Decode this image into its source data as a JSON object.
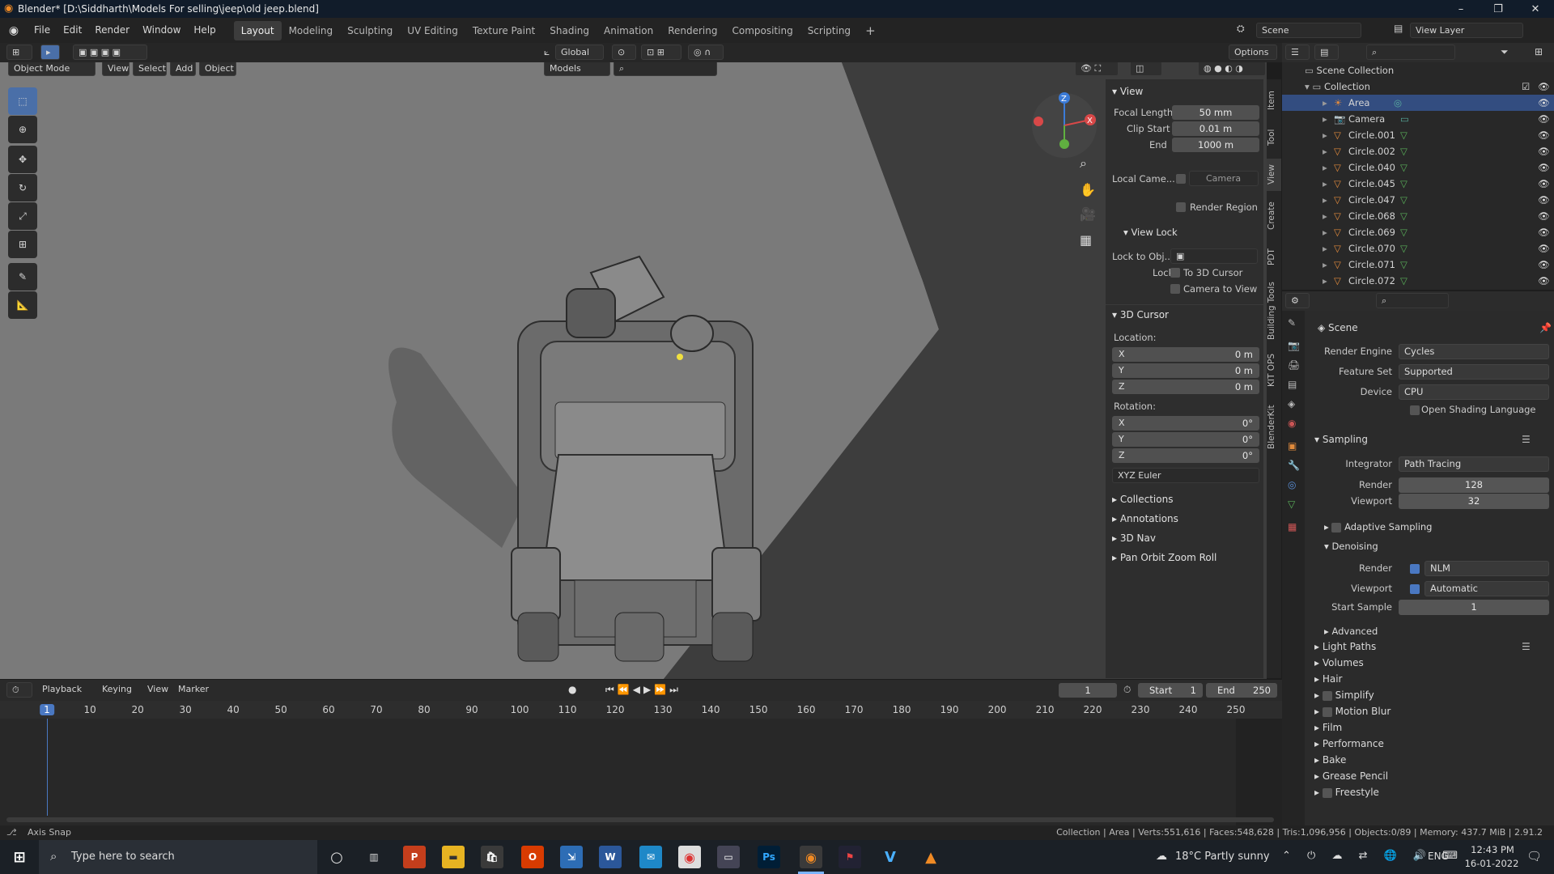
{
  "window": {
    "title": "Blender* [D:\\Siddharth\\Models For selling\\jeep\\old jeep.blend]",
    "minimize": "–",
    "restore": "❐",
    "close": "✕"
  },
  "menu": [
    "File",
    "Edit",
    "Render",
    "Window",
    "Help"
  ],
  "workspaces": [
    "Layout",
    "Modeling",
    "Sculpting",
    "UV Editing",
    "Texture Paint",
    "Shading",
    "Animation",
    "Rendering",
    "Compositing",
    "Scripting"
  ],
  "scene": {
    "name": "Scene",
    "view_layer": "View Layer"
  },
  "header": {
    "transform_orientation": "Global",
    "options": "Options",
    "mode": "Object Mode",
    "view": "View",
    "select": "Select",
    "add": "Add",
    "object": "Object",
    "collection_filter": "Models"
  },
  "npanel": {
    "view_title": "View",
    "focal_length_label": "Focal Length",
    "focal_length": "50 mm",
    "clip_start_label": "Clip Start",
    "clip_start": "0.01 m",
    "end_label": "End",
    "clip_end": "1000 m",
    "local_camera_label": "Local Came...",
    "local_camera": "Camera",
    "render_region": "Render Region",
    "view_lock_title": "View Lock",
    "lock_to_obj_label": "Lock to Obj...",
    "lock_label": "Lock",
    "to_3d_cursor": "To 3D Cursor",
    "camera_to_view": "Camera to View",
    "cursor_title": "3D Cursor",
    "location_label": "Location:",
    "loc_x": "0 m",
    "loc_y": "0 m",
    "loc_z": "0 m",
    "rotation_label": "Rotation:",
    "rot_x": "0°",
    "rot_y": "0°",
    "rot_z": "0°",
    "rotation_mode": "XYZ Euler",
    "x": "X",
    "y": "Y",
    "z": "Z",
    "panels": [
      "Collections",
      "Annotations",
      "3D Nav",
      "Pan Orbit Zoom Roll"
    ]
  },
  "sidebar_tabs": [
    "Item",
    "Tool",
    "View",
    "Create",
    "PDT",
    "Building Tools",
    "KIT OPS",
    "BlenderKit"
  ],
  "outliner": {
    "scene_collection": "Scene Collection",
    "collection": "Collection",
    "items": [
      "Area",
      "Camera",
      "Circle.001",
      "Circle.002",
      "Circle.040",
      "Circle.045",
      "Circle.047",
      "Circle.068",
      "Circle.069",
      "Circle.070",
      "Circle.071",
      "Circle.072"
    ]
  },
  "properties": {
    "scene": "Scene",
    "render_engine_label": "Render Engine",
    "render_engine": "Cycles",
    "feature_set_label": "Feature Set",
    "feature_set": "Supported",
    "device_label": "Device",
    "device": "CPU",
    "osl": "Open Shading Language",
    "sampling": "Sampling",
    "integrator_label": "Integrator",
    "integrator": "Path Tracing",
    "render_label": "Render",
    "render_samples": "128",
    "viewport_label": "Viewport",
    "viewport_samples": "32",
    "adaptive_sampling": "Adaptive Sampling",
    "denoising": "Denoising",
    "denoise_render": "NLM",
    "denoise_viewport": "Automatic",
    "start_sample_label": "Start Sample",
    "start_sample": "1",
    "advanced": "Advanced",
    "sections": [
      "Light Paths",
      "Volumes",
      "Hair",
      "Simplify",
      "Motion Blur",
      "Film",
      "Performance",
      "Bake",
      "Grease Pencil",
      "Freestyle"
    ]
  },
  "timeline": {
    "playback": "Playback",
    "keying": "Keying",
    "view": "View",
    "marker": "Marker",
    "current_frame": "1",
    "start_label": "Start",
    "start": "1",
    "end_label": "End",
    "end": "250",
    "ruler": [
      "1",
      "10",
      "20",
      "30",
      "40",
      "50",
      "60",
      "70",
      "80",
      "90",
      "100",
      "110",
      "120",
      "130",
      "140",
      "150",
      "160",
      "170",
      "180",
      "190",
      "200",
      "210",
      "220",
      "230",
      "240",
      "250"
    ]
  },
  "status": {
    "left": "Axis Snap",
    "right": "Collection | Area | Verts:551,616 | Faces:548,628 | Tris:1,096,956 | Objects:0/89 | Memory: 437.7 MiB | 2.91.2"
  },
  "taskbar": {
    "search": "Type here to search",
    "weather": "18°C  Partly sunny",
    "lang": "ENG",
    "time": "12:43 PM",
    "date": "16-01-2022"
  }
}
